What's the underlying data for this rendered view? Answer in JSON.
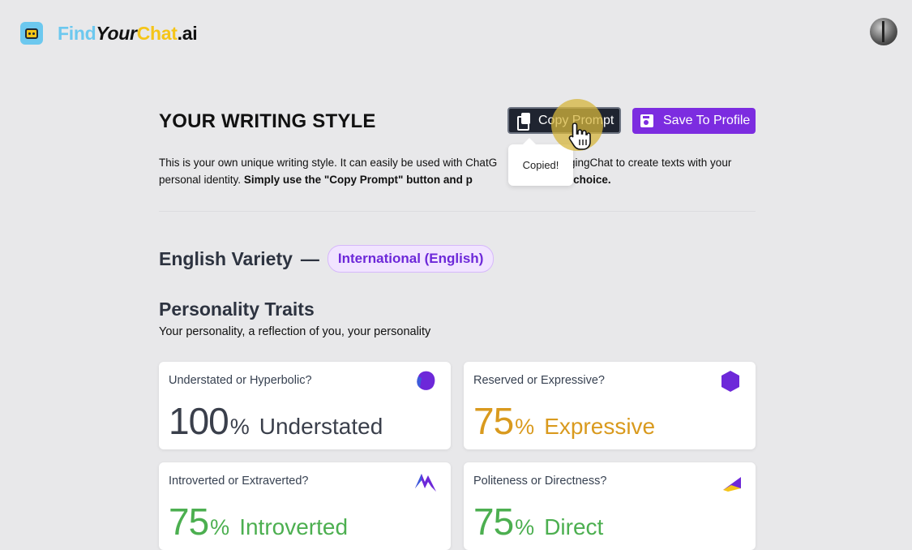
{
  "header": {
    "logo": {
      "find": "Find",
      "your": "Your",
      "chat": "Chat",
      "ai": ".ai"
    }
  },
  "page": {
    "title": "YOUR WRITING STYLE",
    "copy_button": "Copy Prompt",
    "save_button": "Save To Profile",
    "tooltip": "Copied!",
    "intro_part1": "This is your own unique writing style. It can easily be used with ChatG",
    "intro_part2": "HuggingChat to create texts with your personal identity. ",
    "intro_bold": "Simply use the \"Copy Prompt\" button and p",
    "intro_bold_end": "ur tool of choice."
  },
  "variety": {
    "label": "English Variety",
    "dash": "—",
    "value": "International (English)"
  },
  "traits": {
    "title": "Personality Traits",
    "subtitle": "Your personality, a reflection of you, your personality",
    "cards": [
      {
        "question": "Understated or Hyperbolic?",
        "value": "100",
        "unit": "%",
        "label": "Understated",
        "color": "#3a3f4b"
      },
      {
        "question": "Reserved or Expressive?",
        "value": "75",
        "unit": "%",
        "label": "Expressive",
        "color": "#d99a1e"
      },
      {
        "question": "Introverted or Extraverted?",
        "value": "75",
        "unit": "%",
        "label": "Introverted",
        "color": "#4caf50"
      },
      {
        "question": "Politeness or Directness?",
        "value": "75",
        "unit": "%",
        "label": "Direct",
        "color": "#4caf50"
      }
    ]
  },
  "colors": {
    "accent_purple": "#7c2ce0",
    "dark_button": "#1f2430",
    "page_bg": "#e8e8ea"
  }
}
